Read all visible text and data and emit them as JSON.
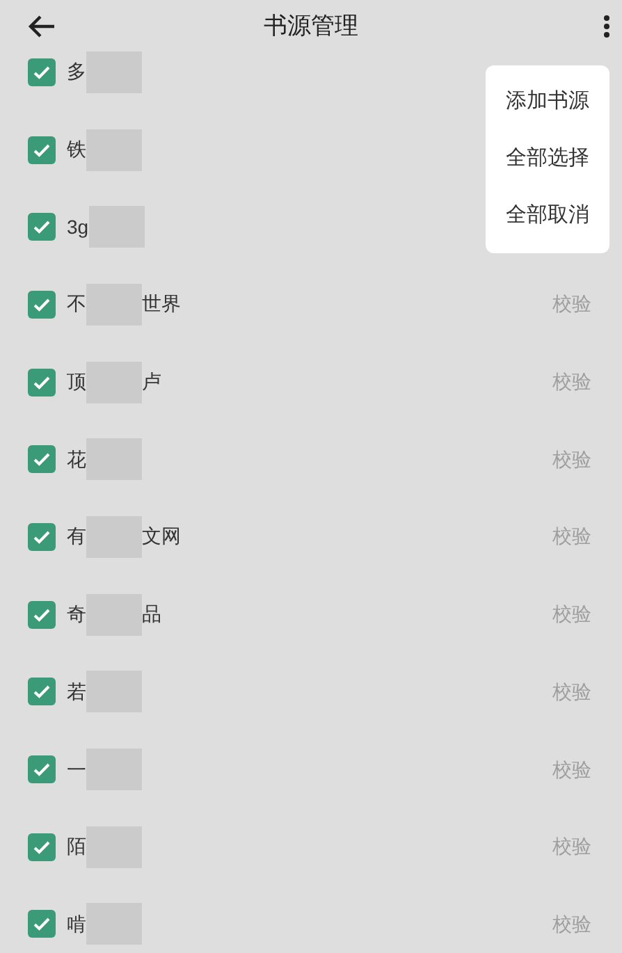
{
  "header": {
    "title": "书源管理"
  },
  "sources": [
    {
      "checked": true,
      "name_parts": [
        "多"
      ]
    },
    {
      "checked": true,
      "name_parts": [
        "铁"
      ]
    },
    {
      "checked": true,
      "name_parts": [
        "3g"
      ]
    },
    {
      "checked": true,
      "name_parts": [
        "不",
        "世界"
      ],
      "action": "校验"
    },
    {
      "checked": true,
      "name_parts": [
        "顶",
        "卢"
      ],
      "action": "校验"
    },
    {
      "checked": true,
      "name_parts": [
        "花"
      ],
      "action": "校验"
    },
    {
      "checked": true,
      "name_parts": [
        "有",
        "文网"
      ],
      "action": "校验"
    },
    {
      "checked": true,
      "name_parts": [
        "奇",
        "品"
      ],
      "action": "校验"
    },
    {
      "checked": true,
      "name_parts": [
        "若"
      ],
      "action": "校验"
    },
    {
      "checked": true,
      "name_parts": [
        "一"
      ],
      "action": "校验"
    },
    {
      "checked": true,
      "name_parts": [
        "陌"
      ],
      "action": "校验"
    },
    {
      "checked": true,
      "name_parts": [
        "啃"
      ],
      "action": "校验"
    }
  ],
  "menu": {
    "items": [
      "添加书源",
      "全部选择",
      "全部取消"
    ]
  }
}
